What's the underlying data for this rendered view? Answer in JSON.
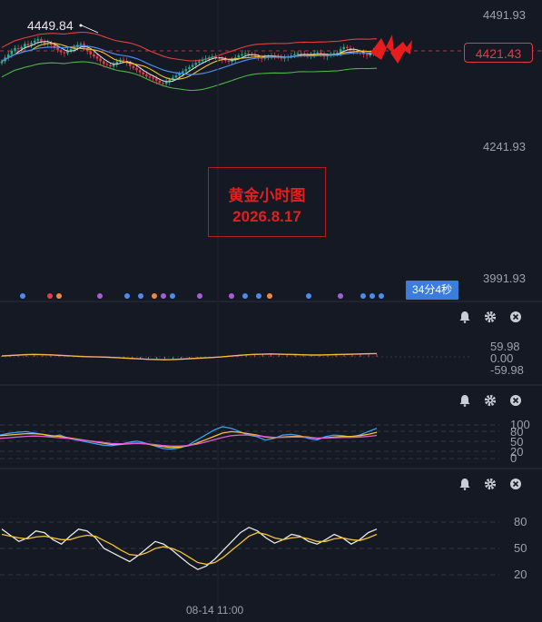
{
  "chart_data": [
    {
      "type": "candlestick",
      "title": "",
      "price_axis_ticks": [
        "4491.93",
        "4241.93",
        "3991.93"
      ],
      "price_axis_values": [
        4491.93,
        4241.93,
        3991.93
      ],
      "current_price": "4421.43",
      "current_price_value": 4421.43,
      "high_marker": "4449.84",
      "annotation_lines": [
        "黄金小时图",
        "2026.8.17"
      ],
      "countdown": "34分4秒",
      "x_axis_label": "08-14 11:00",
      "ylim": [
        3991.93,
        4491.93
      ],
      "bar_count": 115,
      "candles_close": [
        4405,
        4412,
        4418,
        4425,
        4430,
        4428,
        4432,
        4438,
        4435,
        4440,
        4444,
        4447,
        4442,
        4438,
        4440,
        4436,
        4430,
        4426,
        4422,
        4420,
        4425,
        4428,
        4432,
        4436,
        4438,
        4430,
        4424,
        4418,
        4414,
        4410,
        4405,
        4400,
        4398,
        4395,
        4400,
        4404,
        4408,
        4406,
        4402,
        4396,
        4392,
        4388,
        4384,
        4380,
        4376,
        4374,
        4372,
        4368,
        4364,
        4362,
        4366,
        4370,
        4374,
        4378,
        4382,
        4386,
        4390,
        4394,
        4398,
        4402,
        4405,
        4408,
        4410,
        4412,
        4414,
        4412,
        4410,
        4408,
        4406,
        4404,
        4408,
        4412,
        4416,
        4418,
        4420,
        4418,
        4416,
        4414,
        4412,
        4410,
        4412,
        4414,
        4416,
        4415,
        4413,
        4410,
        4412,
        4414,
        4416,
        4418,
        4420,
        4419,
        4417,
        4415,
        4418,
        4420,
        4422,
        4418,
        4414,
        4416,
        4418,
        4420,
        4421.43,
        4428,
        4432,
        4430,
        4426,
        4424,
        4422,
        4421.43,
        4418,
        4416,
        4420,
        4424,
        4421.43
      ],
      "bollinger_upper_end": 4440,
      "bollinger_lower_end": 4375,
      "colors": {
        "up": "#29a986",
        "down": "#e23b4b",
        "upper_band": "#e0413f",
        "lower_band": "#4cb548",
        "ma_fast": "#e4e4e4",
        "ma_mid": "#f2c230",
        "ma_slow": "#4b8cf0"
      },
      "event_dot_colors": [
        "#4b8cf0",
        "#e23b4b",
        "#f0883e",
        "#a55fd6",
        "#4b8cf0",
        "#4b8cf0",
        "#f0883e",
        "#a55fd6",
        "#4b8cf0",
        "#a55fd6",
        "#a55fd6",
        "#4b8cf0",
        "#4b8cf0",
        "#f0883e",
        "#4b8cf0",
        "#a55fd6",
        "#4b8cf0",
        "#4b8cf0",
        "#4b8cf0"
      ]
    },
    {
      "type": "line",
      "title": "",
      "axis_ticks": [
        "59.98",
        "0.00",
        "-59.98"
      ],
      "ylim": [
        -59.98,
        59.98
      ],
      "series": [
        {
          "values": [
            5,
            7,
            9,
            11,
            12,
            11,
            10,
            8,
            6,
            4,
            2,
            1,
            0,
            -1,
            -3,
            -5,
            -7,
            -9,
            -11,
            -12,
            -13,
            -12,
            -10,
            -8,
            -6,
            -4,
            -2,
            0,
            3,
            6,
            9,
            11,
            12,
            13,
            12,
            11,
            10,
            9,
            8,
            8,
            9,
            10,
            11,
            12,
            13,
            14,
            15
          ],
          "color": "#e85ad2"
        },
        {
          "values": [
            4,
            6,
            8,
            10,
            11,
            10,
            9,
            7,
            5,
            3,
            1,
            0,
            -1,
            -2,
            -4,
            -6,
            -8,
            -10,
            -12,
            -13,
            -14,
            -13,
            -11,
            -9,
            -7,
            -5,
            -3,
            0,
            4,
            7,
            10,
            12,
            13,
            14,
            13,
            12,
            11,
            10,
            9,
            9,
            10,
            11,
            12,
            13,
            14,
            15,
            16
          ],
          "color": "#f2c230"
        }
      ]
    },
    {
      "type": "line",
      "title": "",
      "axis_ticks": [
        "100",
        "80",
        "50",
        "20",
        "0"
      ],
      "ylim": [
        0,
        100
      ],
      "series": [
        {
          "values": [
            70,
            75,
            78,
            80,
            76,
            72,
            65,
            70,
            60,
            55,
            50,
            45,
            40,
            38,
            42,
            48,
            52,
            46,
            38,
            30,
            28,
            32,
            40,
            55,
            70,
            85,
            95,
            90,
            80,
            70,
            65,
            55,
            60,
            70,
            72,
            68,
            60,
            55,
            65,
            70,
            68,
            64,
            70,
            80,
            90
          ],
          "color": "#3aa0f5"
        },
        {
          "values": [
            68,
            70,
            72,
            74,
            74,
            72,
            68,
            66,
            62,
            58,
            54,
            50,
            46,
            42,
            42,
            44,
            46,
            44,
            40,
            36,
            33,
            34,
            38,
            46,
            56,
            66,
            76,
            80,
            78,
            74,
            70,
            64,
            62,
            64,
            66,
            66,
            64,
            60,
            62,
            64,
            66,
            66,
            68,
            72,
            78
          ],
          "color": "#f2c230"
        },
        {
          "values": [
            60,
            62,
            64,
            66,
            67,
            66,
            64,
            62,
            60,
            57,
            54,
            51,
            48,
            45,
            44,
            44,
            45,
            44,
            42,
            39,
            37,
            37,
            39,
            43,
            49,
            56,
            63,
            68,
            70,
            70,
            68,
            65,
            63,
            63,
            64,
            64,
            63,
            61,
            61,
            62,
            63,
            63,
            64,
            66,
            69
          ],
          "color": "#e85ad2"
        }
      ]
    },
    {
      "type": "line",
      "title": "",
      "axis_ticks": [
        "80",
        "50",
        "20"
      ],
      "ylim": [
        10,
        90
      ],
      "series": [
        {
          "values": [
            72,
            65,
            58,
            62,
            70,
            68,
            60,
            55,
            64,
            72,
            70,
            62,
            50,
            45,
            40,
            35,
            42,
            50,
            58,
            55,
            48,
            40,
            32,
            26,
            30,
            38,
            48,
            58,
            68,
            74,
            70,
            62,
            56,
            60,
            66,
            64,
            58,
            55,
            60,
            66,
            62,
            55,
            60,
            68,
            72
          ],
          "color": "#e8e8e8"
        },
        {
          "values": [
            66,
            64,
            62,
            61,
            63,
            64,
            62,
            60,
            60,
            63,
            65,
            64,
            59,
            54,
            48,
            43,
            42,
            45,
            50,
            52,
            50,
            46,
            40,
            34,
            32,
            34,
            40,
            48,
            56,
            64,
            68,
            66,
            62,
            60,
            62,
            63,
            61,
            58,
            58,
            61,
            62,
            60,
            59,
            62,
            66
          ],
          "color": "#f2c230"
        }
      ]
    }
  ],
  "panes": {
    "icons": [
      "bell-icon",
      "gear-icon",
      "close-icon"
    ]
  }
}
